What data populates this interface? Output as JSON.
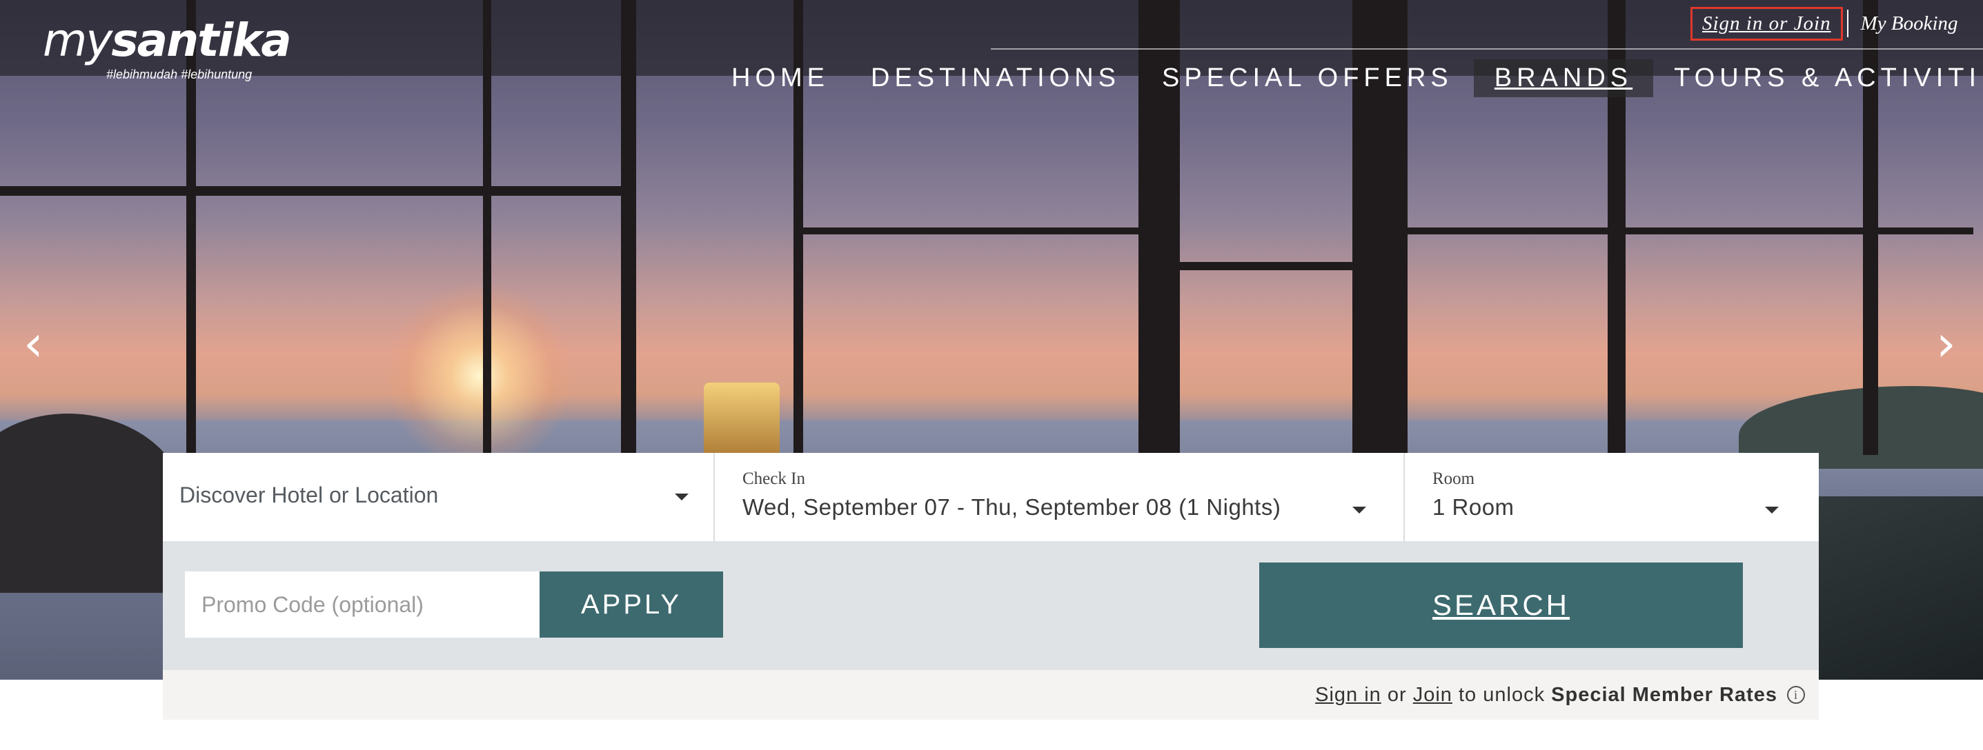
{
  "logo": {
    "text_light": "my",
    "text_bold": "santika",
    "tagline": "#lebihmudah #lebihuntung"
  },
  "header": {
    "signin_label": "Sign in or Join",
    "mybooking_label": "My Booking"
  },
  "nav": {
    "items": [
      {
        "label": "HOME"
      },
      {
        "label": "DESTINATIONS"
      },
      {
        "label": "SPECIAL OFFERS"
      },
      {
        "label": "BRANDS",
        "active": true
      },
      {
        "label": "TOURS & ACTIVITIES"
      }
    ]
  },
  "carousel": {
    "prev_icon": "chevron-left-icon",
    "next_icon": "chevron-right-icon",
    "prev_glyph": "‹",
    "next_glyph": "›"
  },
  "booking": {
    "location_placeholder": "Discover Hotel or Location",
    "checkin_label": "Check In",
    "checkin_value": "Wed, September 07 - Thu, September 08 (1 Nights)",
    "room_label": "Room",
    "room_value": "1 Room",
    "promo_placeholder": "Promo Code (optional)",
    "apply_label": "APPLY",
    "search_label": "SEARCH"
  },
  "member_bar": {
    "signin": "Sign in",
    "or": "or",
    "join": "Join",
    "unlock": "to unlock",
    "rates": "Special Member Rates",
    "info_glyph": "i"
  },
  "colors": {
    "accent": "#3d6a6f",
    "highlight_border": "#e0382b",
    "widget_band": "#dfe3e6",
    "member_bar": "#f4f3f1"
  }
}
